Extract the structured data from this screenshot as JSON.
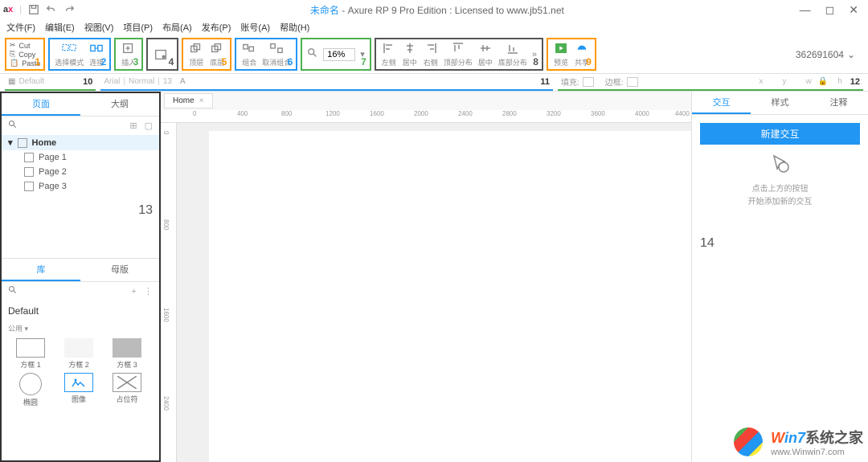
{
  "titlebar": {
    "unnamed": "未命名",
    "suffix": " - Axure RP 9 Pro Edition : Licensed to www.jb51.net"
  },
  "menu": [
    "文件(F)",
    "编辑(E)",
    "视图(V)",
    "项目(P)",
    "布局(A)",
    "发布(P)",
    "账号(A)",
    "帮助(H)"
  ],
  "toolbar": {
    "g1": {
      "cut": "Cut",
      "copy": "Copy",
      "paste": "Paste",
      "num": "1"
    },
    "g2": {
      "a": "选择模式",
      "b": "连接",
      "num": "2"
    },
    "g3": {
      "a": "插入",
      "num": "3"
    },
    "g4": {
      "num": "4"
    },
    "g5": {
      "a": "顶层",
      "b": "底层",
      "num": "5"
    },
    "g6": {
      "a": "组合",
      "b": "取消组合",
      "num": "6"
    },
    "g7": {
      "zoom": "16%",
      "num": "7"
    },
    "g8": {
      "a": "左侧",
      "b": "居中",
      "c": "右侧",
      "d": "顶部分布",
      "e": "居中",
      "f": "底部分布",
      "num": "8"
    },
    "g9": {
      "a": "预览",
      "b": "共享",
      "num": "9"
    },
    "account": "362691604"
  },
  "formatbar": {
    "default": "Default",
    "font": "Arial",
    "weight": "Normal",
    "size": "13",
    "fill": "填充:",
    "border": "边框:",
    "x": "x",
    "y": "y",
    "w": "w",
    "h": "h",
    "n10": "10",
    "n11": "11",
    "n12": "12"
  },
  "leftPanel": {
    "tabs": {
      "pages": "页面",
      "outline": "大纲"
    },
    "tree": {
      "home": "Home",
      "p1": "Page 1",
      "p2": "Page 2",
      "p3": "Page 3"
    },
    "num": "13",
    "lib": {
      "tabs": {
        "lib": "库",
        "master": "母版"
      },
      "header": "Default",
      "common": "公用 ▾",
      "widgets": [
        "方框 1",
        "方框 2",
        "方框 3",
        "椭圆",
        "图像",
        "占位符"
      ]
    }
  },
  "canvas": {
    "tab": "Home",
    "rulerH": [
      "0",
      "400",
      "800",
      "1200",
      "1600",
      "2000",
      "2400",
      "2800",
      "3200",
      "3600",
      "4000",
      "4400"
    ],
    "rulerV": [
      "0",
      "800",
      "1600",
      "2400"
    ]
  },
  "rightPanel": {
    "tabs": {
      "inter": "交互",
      "style": "样式",
      "notes": "注释"
    },
    "newBtn": "新建交互",
    "hint1": "点击上方的按钮",
    "hint2": "开始添加新的交互",
    "num": "14"
  },
  "watermark": {
    "brand_w": "W",
    "brand_in": "in",
    "brand_7": "7",
    "brand_suffix": "系统之家",
    "url": "www.Winwin7.com"
  }
}
